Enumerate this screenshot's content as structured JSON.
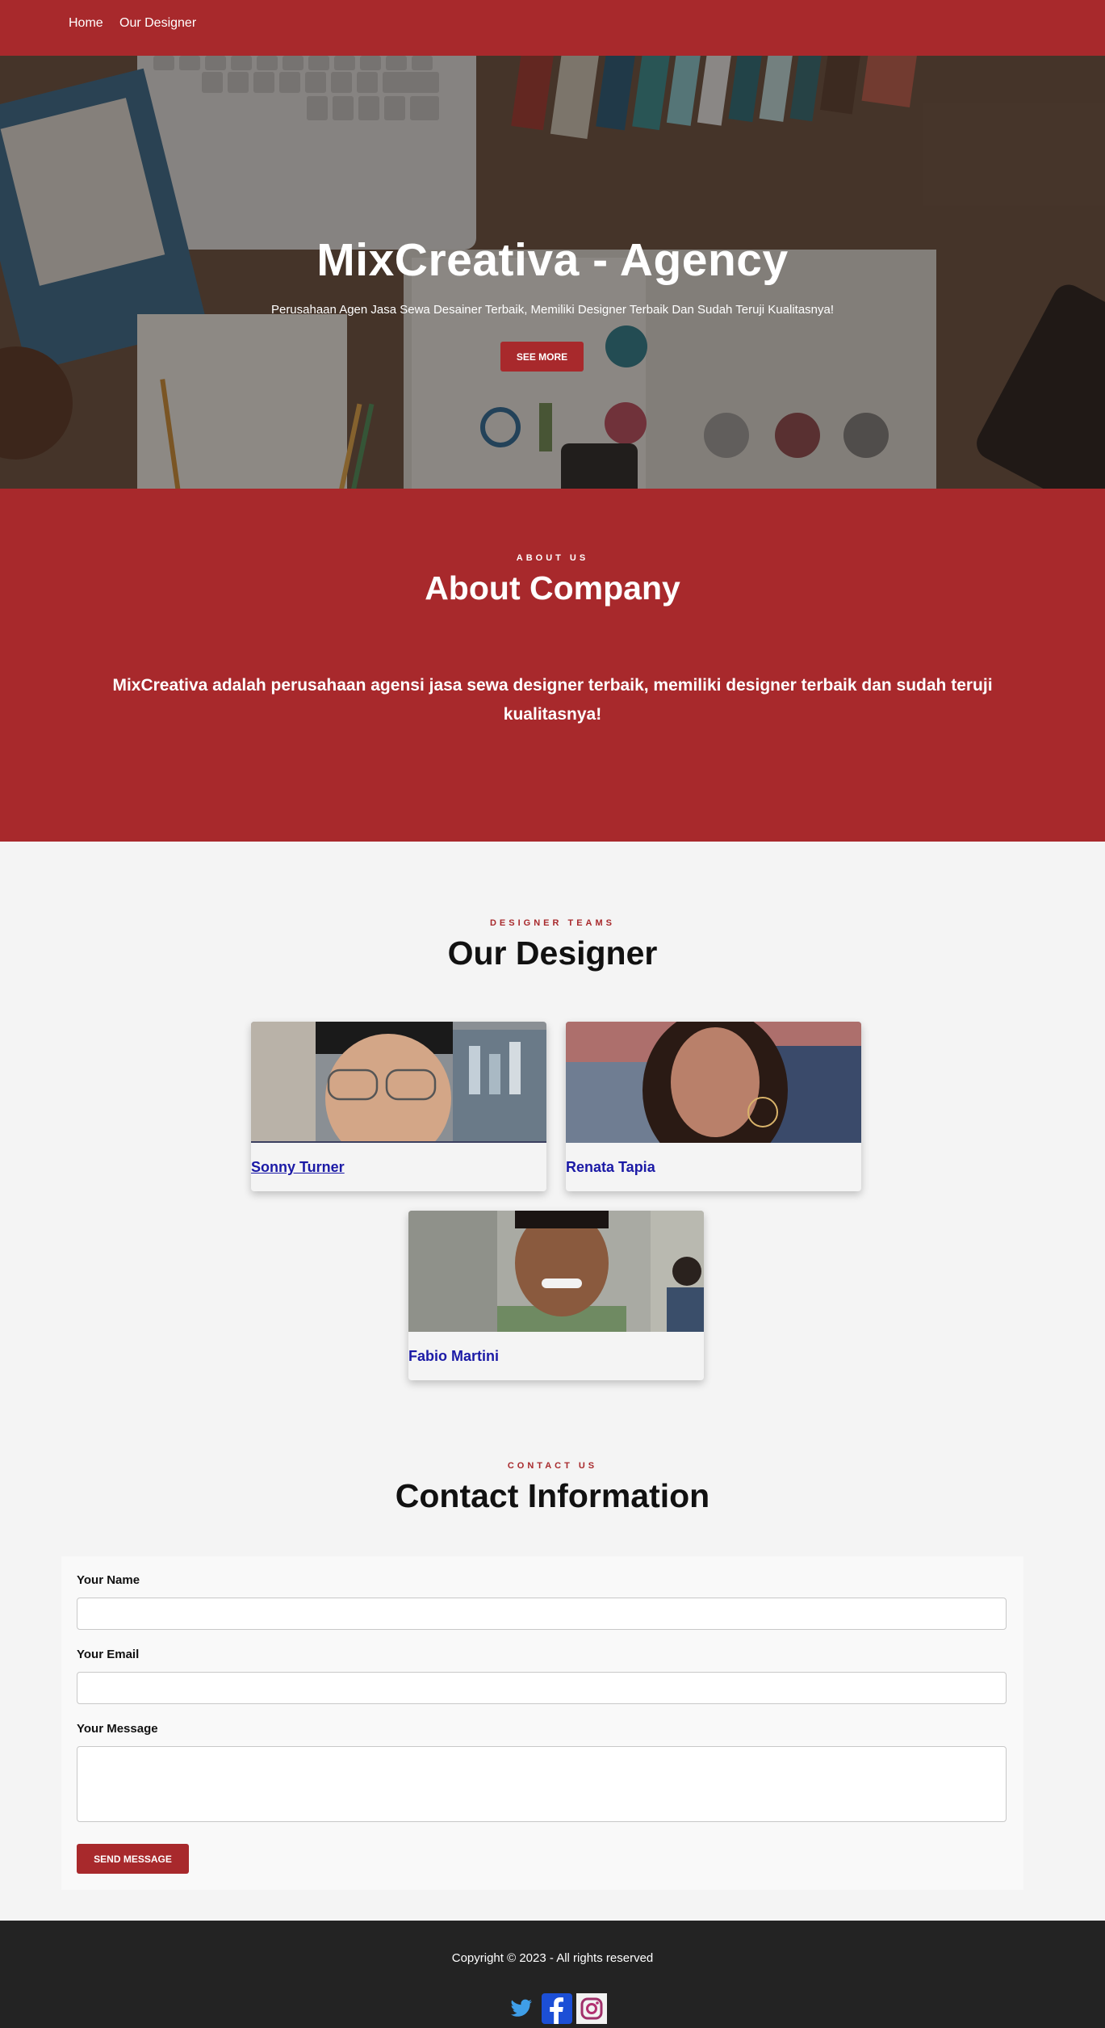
{
  "nav": {
    "home": "Home",
    "designer": "Our Designer"
  },
  "hero": {
    "title": "MixCreativa - Agency",
    "subtitle": "Perusahaan Agen Jasa Sewa Desainer Terbaik, Memiliki Designer Terbaik Dan Sudah Teruji Kualitasnya!",
    "button": "SEE MORE"
  },
  "about": {
    "eyebrow": "ABOUT US",
    "title": "About Company",
    "text": "MixCreativa adalah perusahaan agensi jasa sewa designer terbaik, memiliki designer terbaik dan sudah teruji kualitasnya!"
  },
  "designers": {
    "eyebrow": "DESIGNER TEAMS",
    "title": "Our Designer",
    "items": [
      {
        "name": "Sonny Turner"
      },
      {
        "name": "Renata Tapia"
      },
      {
        "name": "Fabio Martini"
      }
    ]
  },
  "contact": {
    "eyebrow": "CONTACT US",
    "title": "Contact Information",
    "name_label": "Your Name",
    "email_label": "Your Email",
    "message_label": "Your Message",
    "button": "SEND MESSAGE"
  },
  "footer": {
    "copyright": "Copyright © 2023 - All rights reserved"
  },
  "social": [
    "twitter-icon",
    "facebook-icon",
    "instagram-icon"
  ],
  "colors": {
    "brand": "#a8292c",
    "link": "#1b1aa6",
    "footer": "#232323"
  }
}
